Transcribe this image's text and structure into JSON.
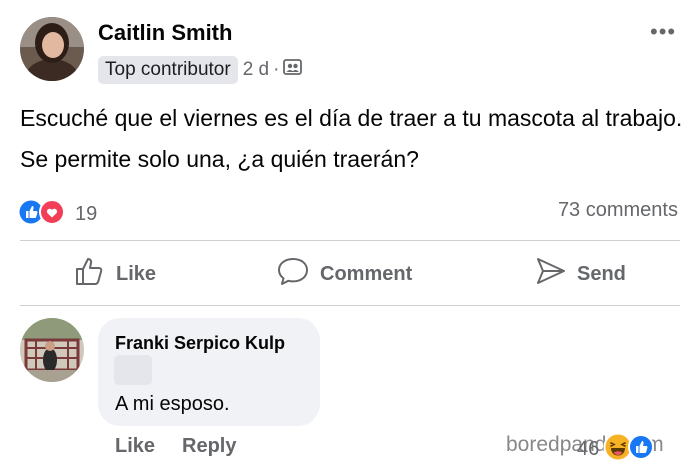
{
  "post": {
    "author": "Caitlin Smith",
    "badge": "Top contributor",
    "time": "2 d",
    "separator": "·",
    "more": "•••",
    "privacy_icon": "friends-icon",
    "text": "Escuché que el viernes es el día de traer a tu mascota al trabajo. Se permite solo una, ¿a quién traerán?",
    "reaction_count": "19",
    "reaction_icons": [
      "like-icon",
      "love-icon"
    ],
    "comments_count": "73 comments"
  },
  "actions": {
    "like": "Like",
    "comment": "Comment",
    "send": "Send"
  },
  "comment": {
    "author": "Franki Serpico Kulp",
    "text": "A mi esposo.",
    "like": "Like",
    "reply": "Reply",
    "reaction_count": "46",
    "reaction_icons": [
      "haha-icon",
      "like-icon"
    ]
  },
  "watermark": "boredpanda.com",
  "colors": {
    "like_blue": "#1877f2",
    "love_red": "#f33e58",
    "haha_yellow": "#f7b125",
    "muted": "#65676b",
    "bubble": "#f0f2f5"
  }
}
